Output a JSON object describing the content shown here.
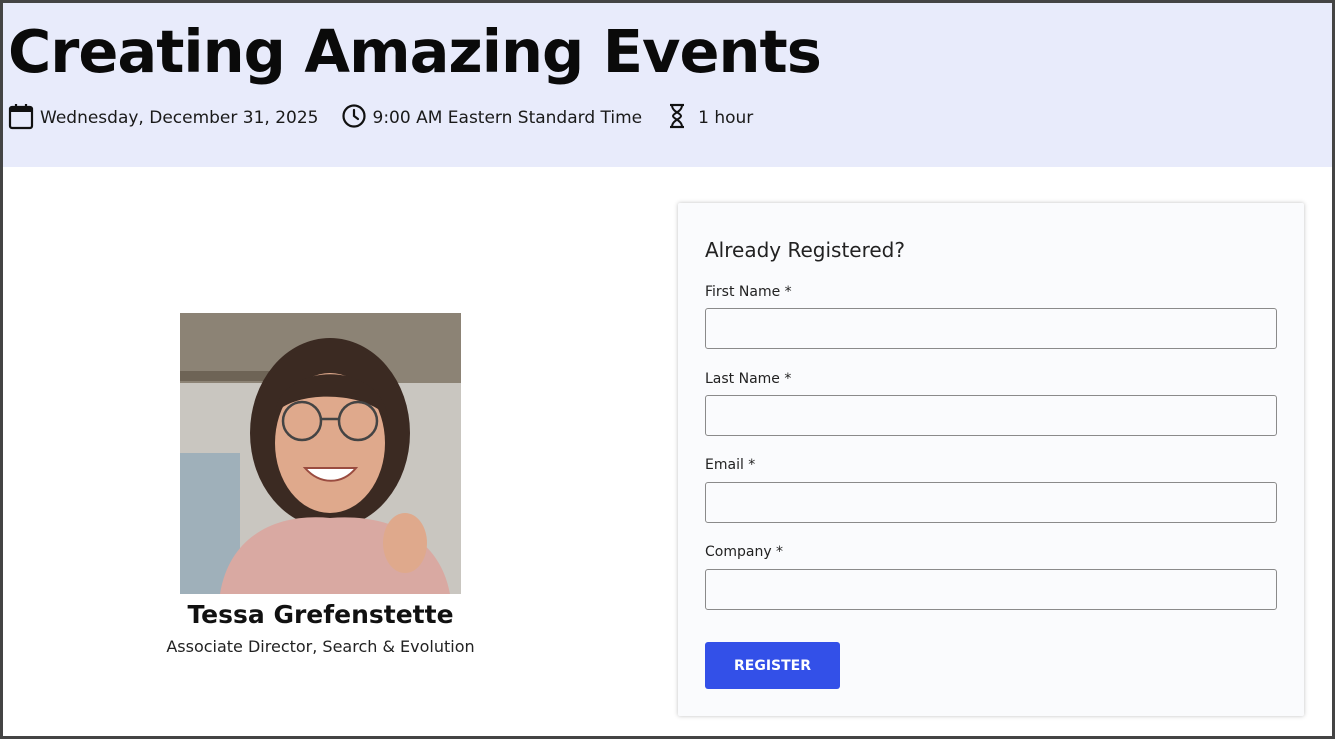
{
  "event": {
    "title": "Creating Amazing Events",
    "date": "Wednesday, December 31, 2025",
    "time": "9:00 AM Eastern Standard Time",
    "duration": "1 hour"
  },
  "speaker": {
    "name": "Tessa Grefenstette",
    "role": "Associate Director, Search & Evolution"
  },
  "form": {
    "heading": "Already Registered?",
    "fields": [
      {
        "label": "First Name *",
        "value": ""
      },
      {
        "label": "Last Name *",
        "value": ""
      },
      {
        "label": "Email *",
        "value": ""
      },
      {
        "label": "Company *",
        "value": ""
      }
    ],
    "submit_label": "REGISTER"
  },
  "colors": {
    "header_bg": "#e8ebfb",
    "button": "#3350e8"
  },
  "icons": [
    "calendar-icon",
    "clock-icon",
    "hourglass-icon"
  ]
}
